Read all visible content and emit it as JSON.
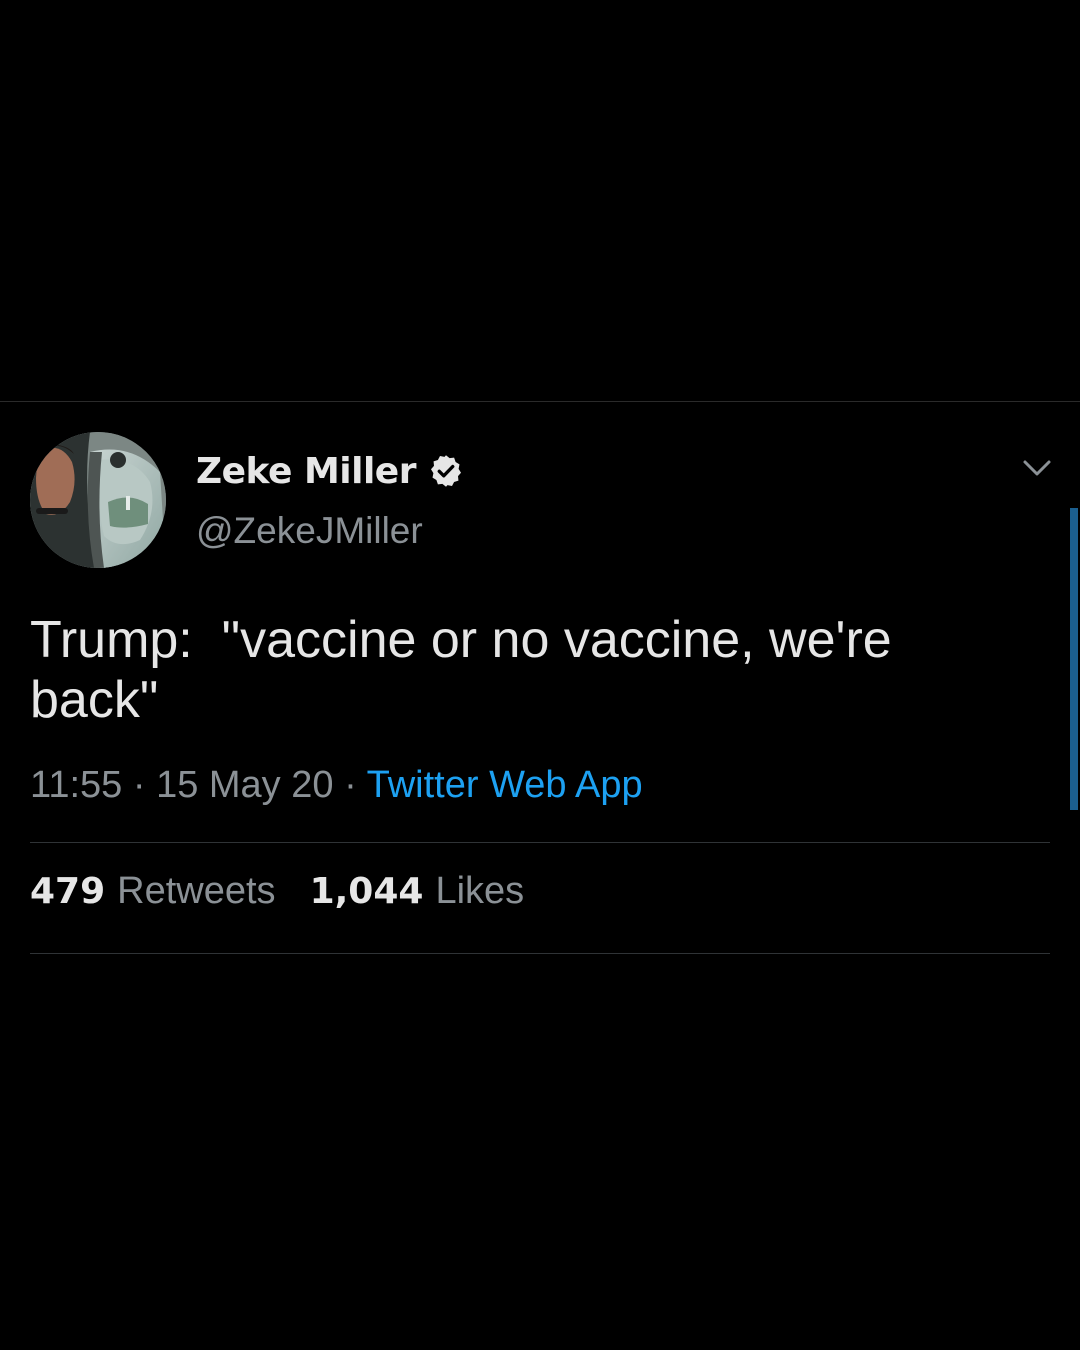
{
  "tweet": {
    "author": {
      "display_name": "Zeke Miller",
      "handle": "@ZekeJMiller",
      "verified": true
    },
    "text": "Trump:  \"vaccine or no vaccine, we're back\"",
    "time": "11:55",
    "date": "15 May 20",
    "separator": "·",
    "source": "Twitter Web App",
    "stats": {
      "retweets_count": "479",
      "retweets_label": "Retweets",
      "likes_count": "1,044",
      "likes_label": "Likes"
    }
  },
  "icons": {
    "verified": "verified-badge-icon",
    "menu": "chevron-down-icon"
  },
  "colors": {
    "background": "#000000",
    "text_primary": "#e6e6e6",
    "text_secondary": "#8b9196",
    "link": "#1da1f2",
    "divider": "#2f3336"
  }
}
